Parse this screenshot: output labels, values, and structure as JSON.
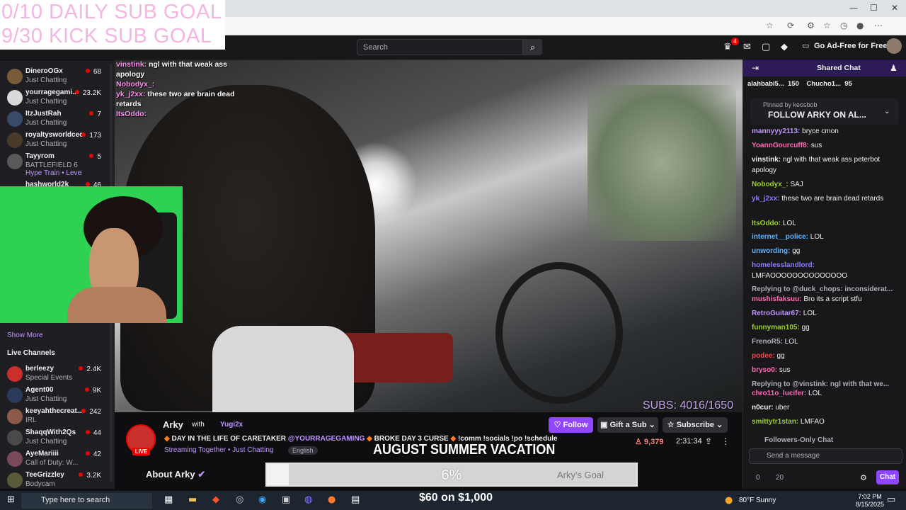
{
  "overlay": {
    "goal_daily": "0/10 DAILY SUB GOAL",
    "goal_kick": "9/30 KICK SUB GOAL"
  },
  "topnav": {
    "search_placeholder": "Search",
    "notif_count": "4",
    "adfree_label": "Go Ad-Free for Free"
  },
  "sidebar": {
    "channels": [
      {
        "name": "DineroOGx",
        "category": "Just Chatting",
        "viewers": "68",
        "color": "#7a5c3a"
      },
      {
        "name": "yourragegami...",
        "category": "Just Chatting",
        "viewers": "23.2K",
        "color": "#d9d9d9"
      },
      {
        "name": "ItzJustRah",
        "category": "Just Chatting",
        "viewers": "7",
        "color": "#3a4a6a"
      },
      {
        "name": "royaltysworldceo",
        "category": "Just Chatting",
        "viewers": "173",
        "color": "#4a3a2a"
      },
      {
        "name": "Tayyrom",
        "category": "BATTLEFIELD 6",
        "viewers": "5",
        "color": "#5a5a5a"
      },
      {
        "name": "hashworld2k",
        "category": "",
        "viewers": "46",
        "color": "#3a3a3a"
      }
    ],
    "hype_train": "Hype Train • Level 1",
    "show_more": "Show More",
    "live_channels_heading": "Live Channels",
    "live_channels": [
      {
        "name": "berleezy",
        "category": "Special Events",
        "viewers": "2.4K",
        "color": "#c9302c"
      },
      {
        "name": "Agent00",
        "category": "Just Chatting",
        "viewers": "9K",
        "color": "#2a3a5a"
      },
      {
        "name": "keeyahthecreat...",
        "category": "IRL",
        "viewers": "242",
        "color": "#8c5a4a"
      },
      {
        "name": "ShaqqWith2Qs",
        "category": "Just Chatting",
        "viewers": "44",
        "color": "#4a4a4a"
      },
      {
        "name": "AyeMariiii",
        "category": "Call of Duty: W...",
        "viewers": "42",
        "color": "#7a4a5a"
      },
      {
        "name": "TeeGrizzley",
        "category": "Bodycam",
        "viewers": "3.2K",
        "color": "#5a5a3a"
      }
    ]
  },
  "video_overlay_chat": [
    {
      "user": "vinstink:",
      "text": " ngl with that weak ass  apology"
    },
    {
      "user": "Nobodyx_:",
      "text": ""
    },
    {
      "user": "yk_j2xx:",
      "text": " these two are brain dead retards"
    },
    {
      "user": "ItsOddo:",
      "text": ""
    }
  ],
  "subs_counter": "SUBS: 4016/1650",
  "stream": {
    "streamer": "Arky",
    "with": "with",
    "collab": "Yugi2x",
    "live": "LIVE",
    "title_a": "DAY IN THE LIFE OF CARETAKER ",
    "title_tag": "@YOURRAGEGAMING",
    "title_b": " BROKE DAY 3 CURSE ",
    "title_c": " !comm !socials !po !schedule",
    "meta": "Streaming Together • Just Chatting",
    "language": "English",
    "follow": "Follow",
    "gift": "Gift a Sub",
    "subscribe": "Subscribe",
    "viewers": "9,379",
    "uptime": "2:31:34",
    "banner": "AUGUST SUMMER VACATION",
    "about": "About Arky",
    "goal_percent": "6%",
    "goal_label": "Arky's Goal",
    "goal_fraction": 0.06
  },
  "chat": {
    "header": "Shared Chat",
    "leaderboard": "alahbabi5...  150    Chucho1...  95",
    "pinned_by": "Pinned by  keosbob",
    "pinned_msg": "FOLLOW ARKY ON AL...",
    "messages": [
      {
        "user": "mannyyy2113:",
        "text": " bryce cmon",
        "color": "#bf94ff"
      },
      {
        "user": "YoannGourcuff8:",
        "text": " sus",
        "color": "#ff69b4"
      },
      {
        "user": "vinstink:",
        "text": " ngl with that weak ass peterbot apology",
        "color": "#efeff1"
      },
      {
        "user": "Nobodyx_:",
        "text": " SAJ",
        "color": "#9acd32"
      },
      {
        "user": "yk_j2xx:",
        "text": " these two are brain dead retards",
        "color": "#8a7cff"
      },
      {
        "user": "ItsOddo:",
        "text": " LOL",
        "color": "#9acd32"
      },
      {
        "user": "internet__police:",
        "text": " LOL",
        "color": "#5fb3ff"
      },
      {
        "user": "unwording:",
        "text": " gg",
        "color": "#5fb3ff"
      },
      {
        "user": "homelesslandlord:",
        "text": " LMFAOOOOOOOOOOOOOO",
        "color": "#8a7cff"
      },
      {
        "user": "Replying to @duck_chops: inconsiderat...",
        "text": "",
        "color": "#adadb8"
      },
      {
        "user": "mushisfaksuu:",
        "text": " Bro its a script stfu",
        "color": "#ff69b4"
      },
      {
        "user": "RetroGuitar67:",
        "text": " LOL",
        "color": "#bf94ff"
      },
      {
        "user": "funnyman105:",
        "text": " gg",
        "color": "#9acd32"
      },
      {
        "user": "FrenoR5:",
        "text": " LOL",
        "color": "#adadb8"
      },
      {
        "user": "podee:",
        "text": " gg",
        "color": "#ff4040"
      },
      {
        "user": "bryso0:",
        "text": " sus",
        "color": "#ff69b4"
      },
      {
        "user": "Replying to @vinstink: ngl with that we...",
        "text": "",
        "color": "#adadb8"
      },
      {
        "user": "chro11o_lucifer:",
        "text": " LOL",
        "color": "#ff69b4"
      },
      {
        "user": "n0cur:",
        "text": " uber",
        "color": "#efeff1"
      },
      {
        "user": "smittytr1stan:",
        "text": " LMFAO",
        "color": "#9acd32"
      }
    ],
    "followers_only": "Followers-Only Chat",
    "input_placeholder": "Send a message",
    "points": "0",
    "points2": "20",
    "chat_button": "Chat"
  },
  "taskbar": {
    "search": "Type here to search",
    "ticker": "$60 on $1,000",
    "weather": "80°F  Sunny",
    "time": "7:02 PM",
    "date": "8/15/2025"
  }
}
